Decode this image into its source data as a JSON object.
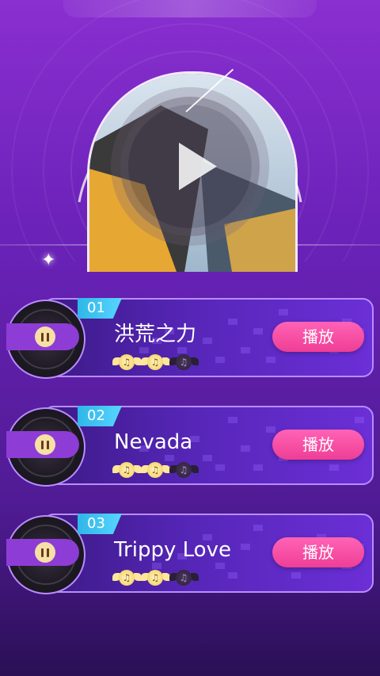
{
  "header": {
    "banner_text": ""
  },
  "now_playing": {
    "cover_icon": "album-cover",
    "play_icon": "play-icon"
  },
  "songs": [
    {
      "number": "01",
      "title": "洪荒之力",
      "play_label": "播放",
      "stars_earned": 2,
      "stars_total": 3
    },
    {
      "number": "02",
      "title": "Nevada",
      "play_label": "播放",
      "stars_earned": 2,
      "stars_total": 3
    },
    {
      "number": "03",
      "title": "Trippy Love",
      "play_label": "播放",
      "stars_earned": 2,
      "stars_total": 3
    }
  ],
  "colors": {
    "accent_pink": "#ef3e95",
    "badge_blue": "#2fb6e8",
    "panel_border": "#b98cff"
  }
}
